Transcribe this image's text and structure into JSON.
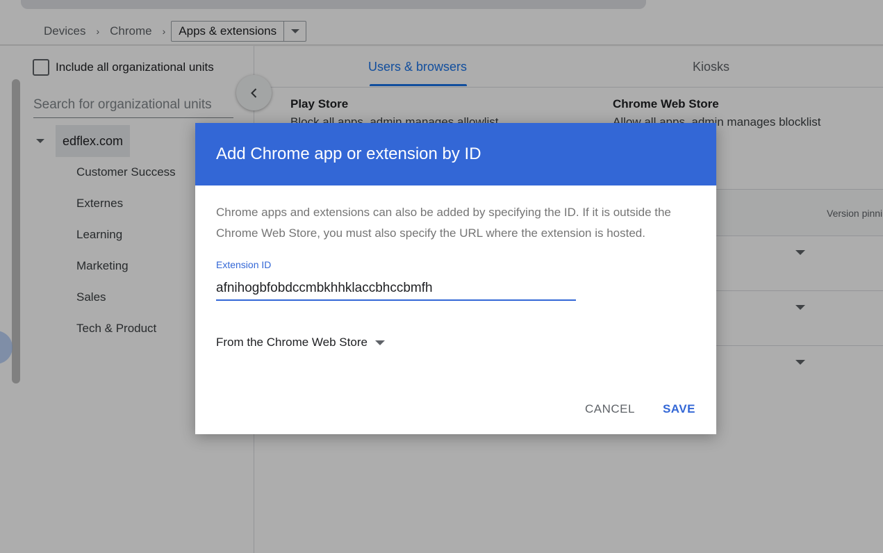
{
  "breadcrumb": {
    "items": [
      "Devices",
      "Chrome"
    ],
    "current": "Apps & extensions"
  },
  "left_panel": {
    "include_all_label": "Include all organizational units",
    "search_placeholder": "Search for organizational units",
    "root_ou": "edflex.com",
    "child_ous": [
      "Customer Success",
      "Externes",
      "Learning",
      "Marketing",
      "Sales",
      "Tech & Product"
    ]
  },
  "tabs": [
    {
      "label": "Users & browsers",
      "active": true
    },
    {
      "label": "Kiosks",
      "active": false
    }
  ],
  "stores": {
    "play_store": {
      "title": "Play Store",
      "description": "Block all apps, admin manages allowlist"
    },
    "chrome_web_store": {
      "title": "Chrome Web Store",
      "description": "Allow all apps, admin manages blocklist"
    }
  },
  "table": {
    "version_column": "Version pinning"
  },
  "dialog": {
    "title": "Add Chrome app or extension by ID",
    "description": "Chrome apps and extensions can also be added by specifying the ID. If it is outside the Chrome Web Store, you must also specify the URL where the extension is hosted.",
    "field_label": "Extension ID",
    "field_value": "afnihogbfobdccmbkhhklaccbhccbmfh",
    "source_selected": "From the Chrome Web Store",
    "cancel_label": "CANCEL",
    "save_label": "SAVE"
  },
  "colors": {
    "dialog_header": "#3367d6",
    "accent": "#1a73e8"
  }
}
